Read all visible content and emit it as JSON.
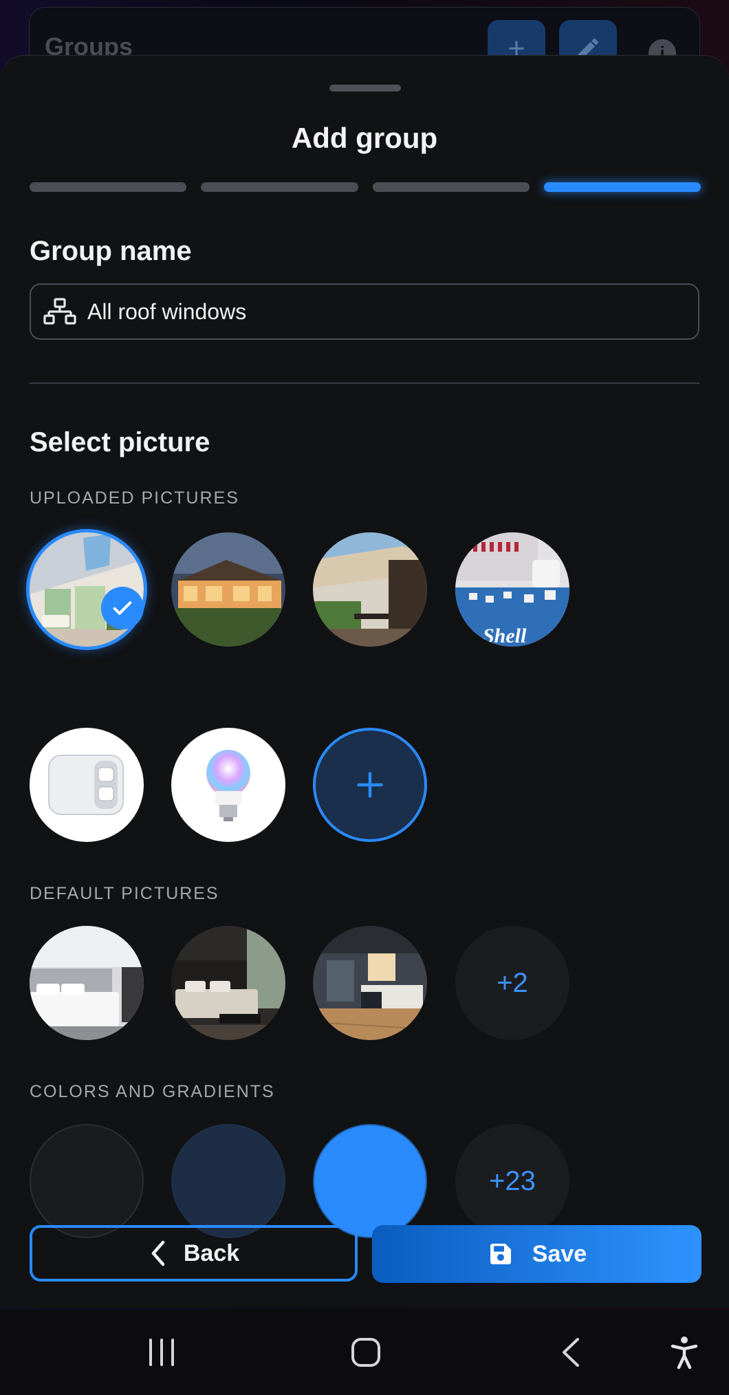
{
  "background_header": {
    "title": "Groups"
  },
  "sheet": {
    "title": "Add group",
    "steps_total": 4,
    "current_step": 4
  },
  "group_name": {
    "section_title": "Group name",
    "value": "All roof windows",
    "icon": "network-icon"
  },
  "select_picture": {
    "section_title": "Select picture",
    "uploaded_label": "UPLOADED PICTURES",
    "uploaded": [
      {
        "name": "roof-window-room",
        "selected": true
      },
      {
        "name": "house-at-night",
        "selected": false
      },
      {
        "name": "patio-awning",
        "selected": false
      },
      {
        "name": "shelly-booth",
        "selected": false
      },
      {
        "name": "white-device",
        "selected": false
      },
      {
        "name": "rgb-bulb",
        "selected": false
      }
    ],
    "default_label": "DEFAULT PICTURES",
    "defaults": [
      "bedroom-white",
      "bedroom-dark",
      "kitchen"
    ],
    "defaults_more": "+2",
    "colors_label": "COLORS AND GRADIENTS",
    "colors": [
      "#1a1b1f",
      "#1d2d45",
      "#2a8bff"
    ],
    "colors_more": "+23"
  },
  "actions": {
    "back_label": "Back",
    "save_label": "Save"
  },
  "accent_color": "#2a8bff"
}
